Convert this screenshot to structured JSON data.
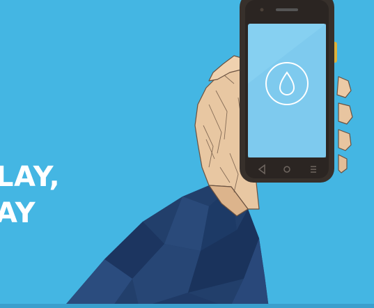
{
  "hero": {
    "headline_line_1": "LAY,",
    "headline_line_2": "AY"
  },
  "phone": {
    "screen_icon": "water-drop-icon",
    "nav_icons": [
      "back-nav-icon",
      "home-nav-icon",
      "menu-nav-icon"
    ]
  },
  "colors": {
    "background": "#44b6e3",
    "phone_body": "#37302b",
    "phone_screen": "#86d0f1",
    "skin": "#e9c9a4",
    "sleeve": "#223f6b",
    "headline": "#ffffff"
  }
}
